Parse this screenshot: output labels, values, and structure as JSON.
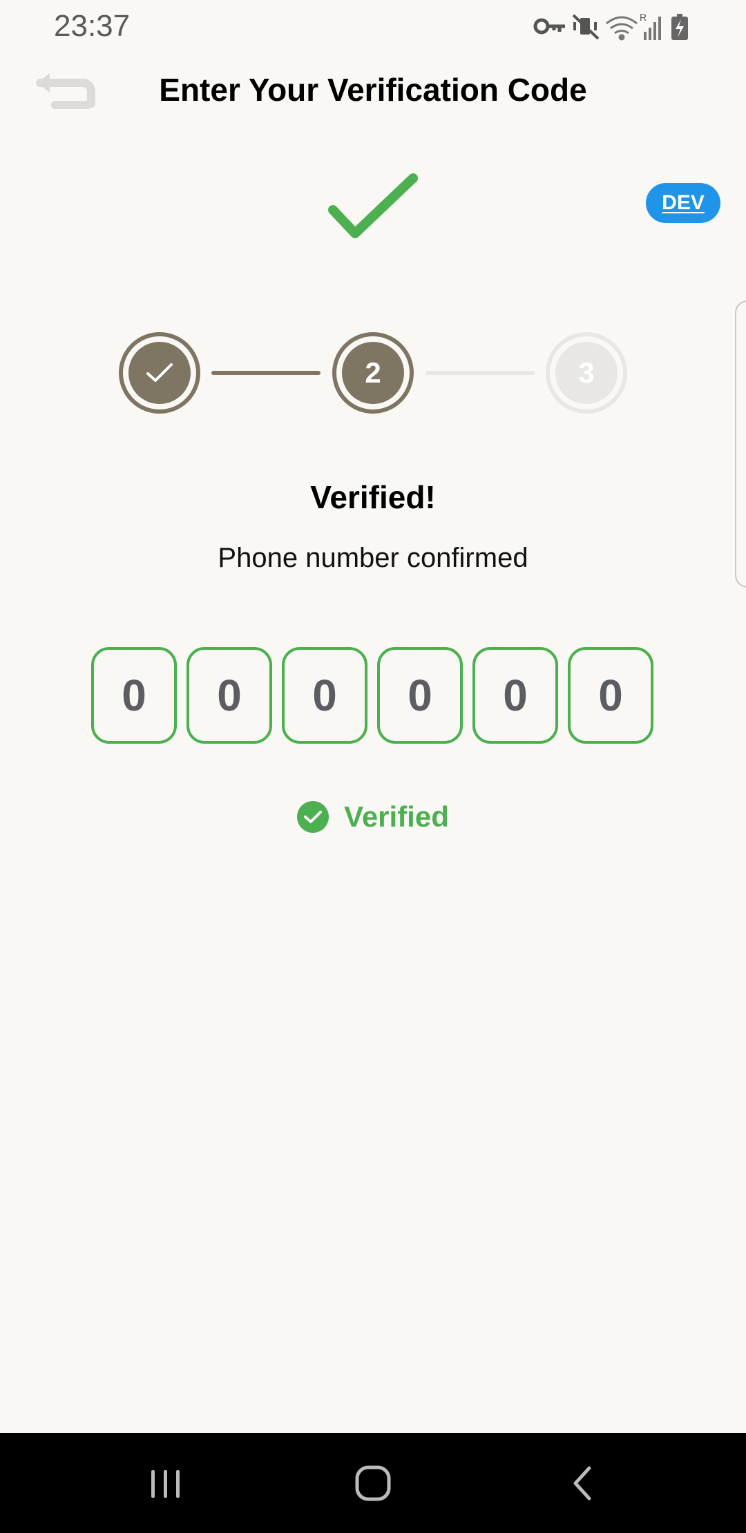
{
  "status_bar": {
    "time": "23:37",
    "icons": [
      "vpn-key-icon",
      "vibrate-mute-icon",
      "wifi-icon",
      "signal-icon",
      "battery-charging-icon"
    ]
  },
  "header": {
    "title": "Enter Your Verification Code",
    "back_icon": "back-arrow-icon"
  },
  "dev_badge": {
    "label": "DEV"
  },
  "stepper": {
    "steps": [
      {
        "state": "completed",
        "label": ""
      },
      {
        "state": "active",
        "label": "2"
      },
      {
        "state": "pending",
        "label": "3"
      }
    ]
  },
  "result": {
    "title": "Verified!",
    "subtitle": "Phone number confirmed"
  },
  "code": {
    "digits": [
      "0",
      "0",
      "0",
      "0",
      "0",
      "0"
    ]
  },
  "status": {
    "label": "Verified"
  },
  "colors": {
    "success": "#4caf50",
    "step_active": "#7e7563",
    "step_pending": "#e8e7e4",
    "dev_badge": "#1f94e8",
    "background": "#f9f8f5"
  },
  "nav_bar": {
    "buttons": [
      "recent-apps-icon",
      "home-icon",
      "back-icon"
    ]
  }
}
